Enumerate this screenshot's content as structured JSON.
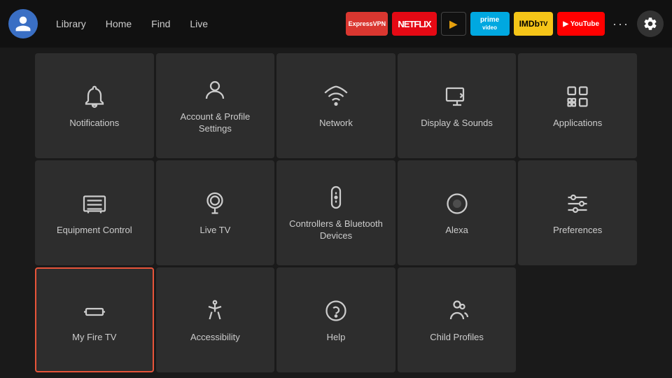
{
  "nav": {
    "library": "Library",
    "home": "Home",
    "find": "Find",
    "live": "Live",
    "more_label": "···"
  },
  "apps": [
    {
      "id": "expressvpn",
      "label": "ExpressVPN",
      "class": "app-expressvpn"
    },
    {
      "id": "netflix",
      "label": "NETFLIX",
      "class": "app-netflix"
    },
    {
      "id": "plex",
      "label": "▶",
      "class": "app-plex"
    },
    {
      "id": "prime",
      "label": "prime video",
      "class": "app-prime"
    },
    {
      "id": "imdb",
      "label": "IMDb TV",
      "class": "app-imdb"
    },
    {
      "id": "youtube",
      "label": "▶ YouTube",
      "class": "app-youtube"
    }
  ],
  "grid": {
    "items": [
      {
        "id": "notifications",
        "label": "Notifications",
        "icon": "bell",
        "selected": false
      },
      {
        "id": "account-profile",
        "label": "Account & Profile Settings",
        "icon": "person",
        "selected": false
      },
      {
        "id": "network",
        "label": "Network",
        "icon": "wifi",
        "selected": false
      },
      {
        "id": "display-sounds",
        "label": "Display & Sounds",
        "icon": "display-sound",
        "selected": false
      },
      {
        "id": "applications",
        "label": "Applications",
        "icon": "apps",
        "selected": false
      },
      {
        "id": "equipment-control",
        "label": "Equipment Control",
        "icon": "tv",
        "selected": false
      },
      {
        "id": "live-tv",
        "label": "Live TV",
        "icon": "antenna",
        "selected": false
      },
      {
        "id": "controllers-bluetooth",
        "label": "Controllers & Bluetooth Devices",
        "icon": "remote",
        "selected": false
      },
      {
        "id": "alexa",
        "label": "Alexa",
        "icon": "alexa",
        "selected": false
      },
      {
        "id": "preferences",
        "label": "Preferences",
        "icon": "sliders",
        "selected": false
      },
      {
        "id": "my-fire-tv",
        "label": "My Fire TV",
        "icon": "firetv",
        "selected": true
      },
      {
        "id": "accessibility",
        "label": "Accessibility",
        "icon": "accessibility",
        "selected": false
      },
      {
        "id": "help",
        "label": "Help",
        "icon": "help",
        "selected": false
      },
      {
        "id": "child-profiles",
        "label": "Child Profiles",
        "icon": "child",
        "selected": false
      }
    ]
  }
}
